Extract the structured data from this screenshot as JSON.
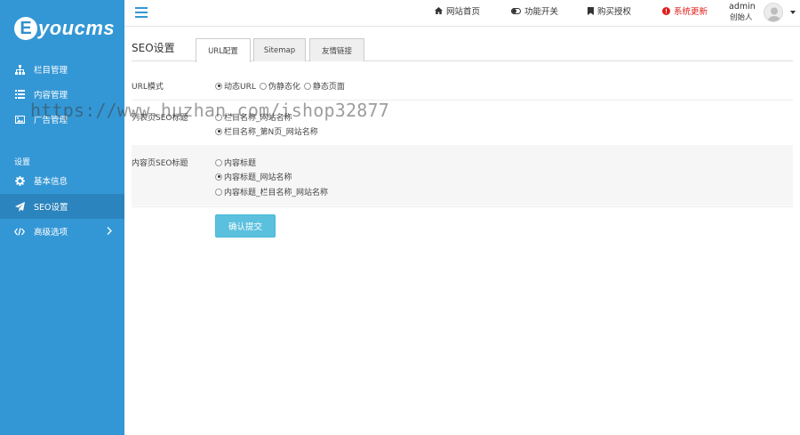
{
  "brand": {
    "logo_letter": "E",
    "logo_text": "youcms"
  },
  "colors": {
    "sidebar": "#3497d5",
    "sidebar_active": "#2b84bd",
    "submit": "#5bc0de",
    "alert": "#e0201b"
  },
  "sidebar": {
    "items": [
      {
        "label": "栏目管理",
        "icon": "sitemap-icon"
      },
      {
        "label": "内容管理",
        "icon": "list-icon"
      },
      {
        "label": "广告管理",
        "icon": "image-icon"
      }
    ],
    "section_label": "设置",
    "settings_items": [
      {
        "label": "基本信息",
        "icon": "gear-icon"
      },
      {
        "label": "SEO设置",
        "icon": "paper-plane-icon",
        "active": true
      },
      {
        "label": "高级选项",
        "icon": "code-icon"
      }
    ]
  },
  "topbar": {
    "links": [
      {
        "label": "网站首页",
        "icon": "home-icon"
      },
      {
        "label": "功能开关",
        "icon": "toggle-icon"
      },
      {
        "label": "购买授权",
        "icon": "bookmark-icon"
      },
      {
        "label": "系统更新",
        "icon": "alert-icon"
      }
    ],
    "user": {
      "name": "admin",
      "role": "创始人"
    }
  },
  "page": {
    "title": "SEO设置",
    "tabs": [
      "URL配置",
      "Sitemap",
      "友情链接"
    ]
  },
  "form": {
    "url_mode": {
      "label": "URL模式",
      "options": [
        "动态URL",
        "伪静态化",
        "静态页面"
      ],
      "selected": 0
    },
    "list_title": {
      "label": "列表页SEO标题",
      "options": [
        "栏目名称_网站名称",
        "栏目名称_第N页_网站名称"
      ],
      "selected": 1
    },
    "content_title": {
      "label": "内容页SEO标题",
      "options": [
        "内容标题",
        "内容标题_网站名称",
        "内容标题_栏目名称_网站名称"
      ],
      "selected": 1
    },
    "submit_label": "确认提交"
  },
  "watermark": "https://www.huzhan.com/ishop32877"
}
